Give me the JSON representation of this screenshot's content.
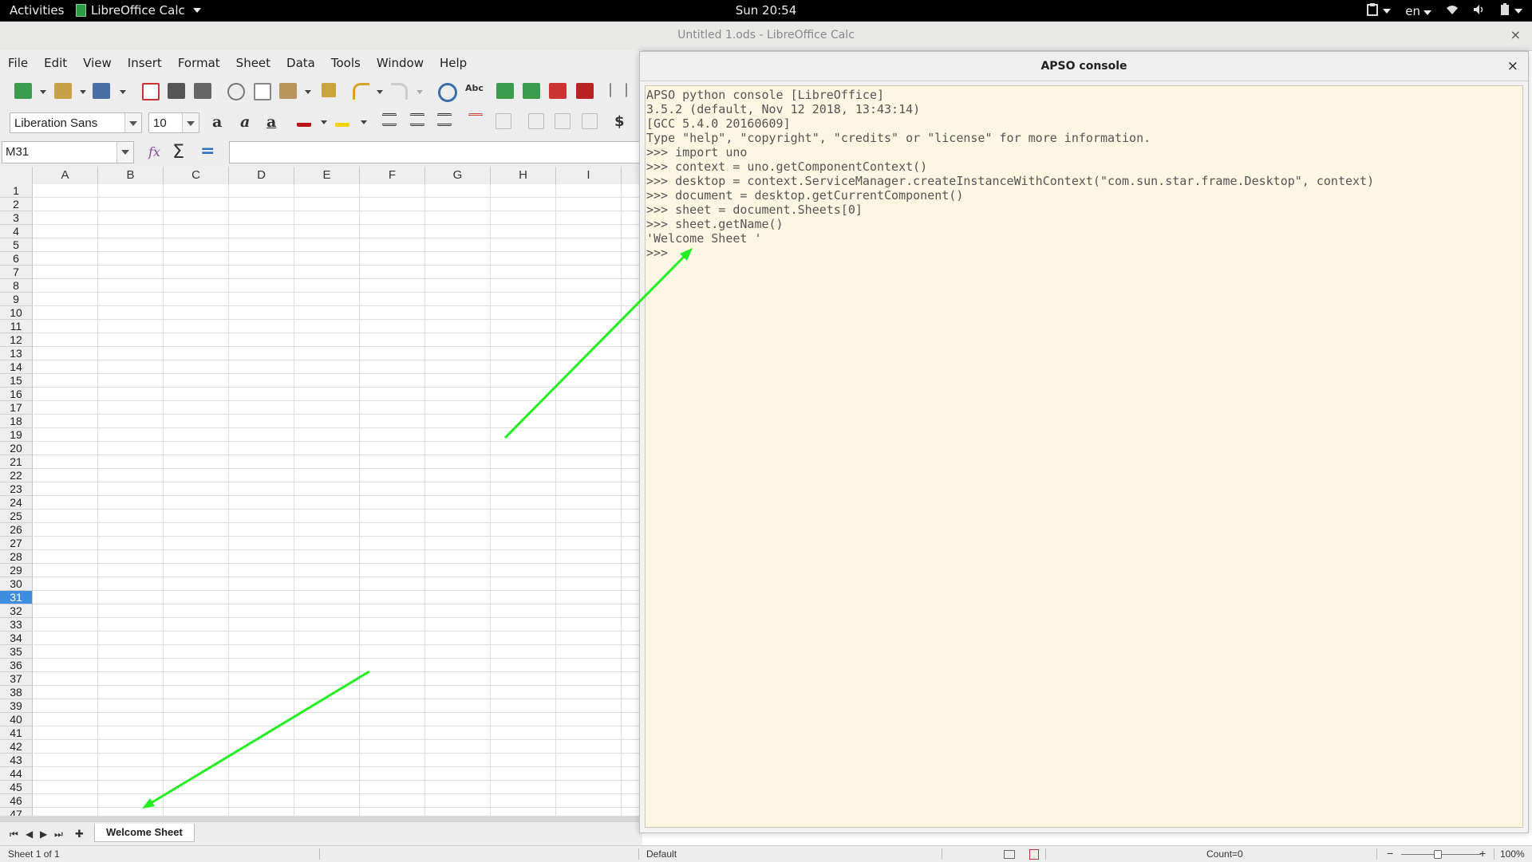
{
  "topbar": {
    "activities": "Activities",
    "app_menu": "LibreOffice Calc",
    "clock": "Sun 20:54",
    "language": "en"
  },
  "window": {
    "title": "Untitled 1.ods - LibreOffice Calc",
    "close": "×"
  },
  "menu": {
    "items": [
      "File",
      "Edit",
      "View",
      "Insert",
      "Format",
      "Sheet",
      "Data",
      "Tools",
      "Window",
      "Help"
    ]
  },
  "toolbar": {
    "font_name": "Liberation Sans",
    "font_size": "10",
    "currency": "$"
  },
  "formula": {
    "cell_ref": "M31",
    "sum": "Σ",
    "equals": "="
  },
  "grid": {
    "columns": [
      "A",
      "B",
      "C",
      "D",
      "E",
      "F",
      "G",
      "H",
      "I"
    ],
    "rows": [
      "1",
      "2",
      "3",
      "4",
      "5",
      "6",
      "7",
      "8",
      "9",
      "10",
      "11",
      "12",
      "13",
      "14",
      "15",
      "16",
      "17",
      "18",
      "19",
      "20",
      "21",
      "22",
      "23",
      "24",
      "25",
      "26",
      "27",
      "28",
      "29",
      "30",
      "31",
      "32",
      "33",
      "34",
      "35",
      "36",
      "37",
      "38",
      "39",
      "40",
      "41",
      "42",
      "43",
      "44",
      "45",
      "46",
      "47"
    ],
    "selected_row": "31"
  },
  "sheet_tabs": {
    "active": "Welcome Sheet",
    "nav": [
      "⏮",
      "◀",
      "▶",
      "⏭"
    ],
    "add": "✚"
  },
  "status": {
    "sheet_position": "Sheet 1 of 1",
    "page_style": "Default",
    "count": "Count=0",
    "zoom": "100%",
    "zoom_minus": "−",
    "zoom_plus": "+"
  },
  "console": {
    "title": "APSO console",
    "close": "×",
    "lines": [
      "APSO python console [LibreOffice]",
      "3.5.2 (default, Nov 12 2018, 13:43:14)",
      "[GCC 5.4.0 20160609]",
      "Type \"help\", \"copyright\", \"credits\" or \"license\" for more information.",
      ">>> import uno",
      ">>> context = uno.getComponentContext()",
      ">>> desktop = context.ServiceManager.createInstanceWithContext(\"com.sun.star.frame.Desktop\", context)",
      ">>> document = desktop.getCurrentComponent()",
      ">>> sheet = document.Sheets[0]",
      ">>> sheet.getName()",
      "'Welcome Sheet '",
      ">>> "
    ]
  },
  "colors": {
    "arrow": "#22ee22",
    "console_bg": "#fdf6e3",
    "row_selected": "#3d8ee0"
  }
}
